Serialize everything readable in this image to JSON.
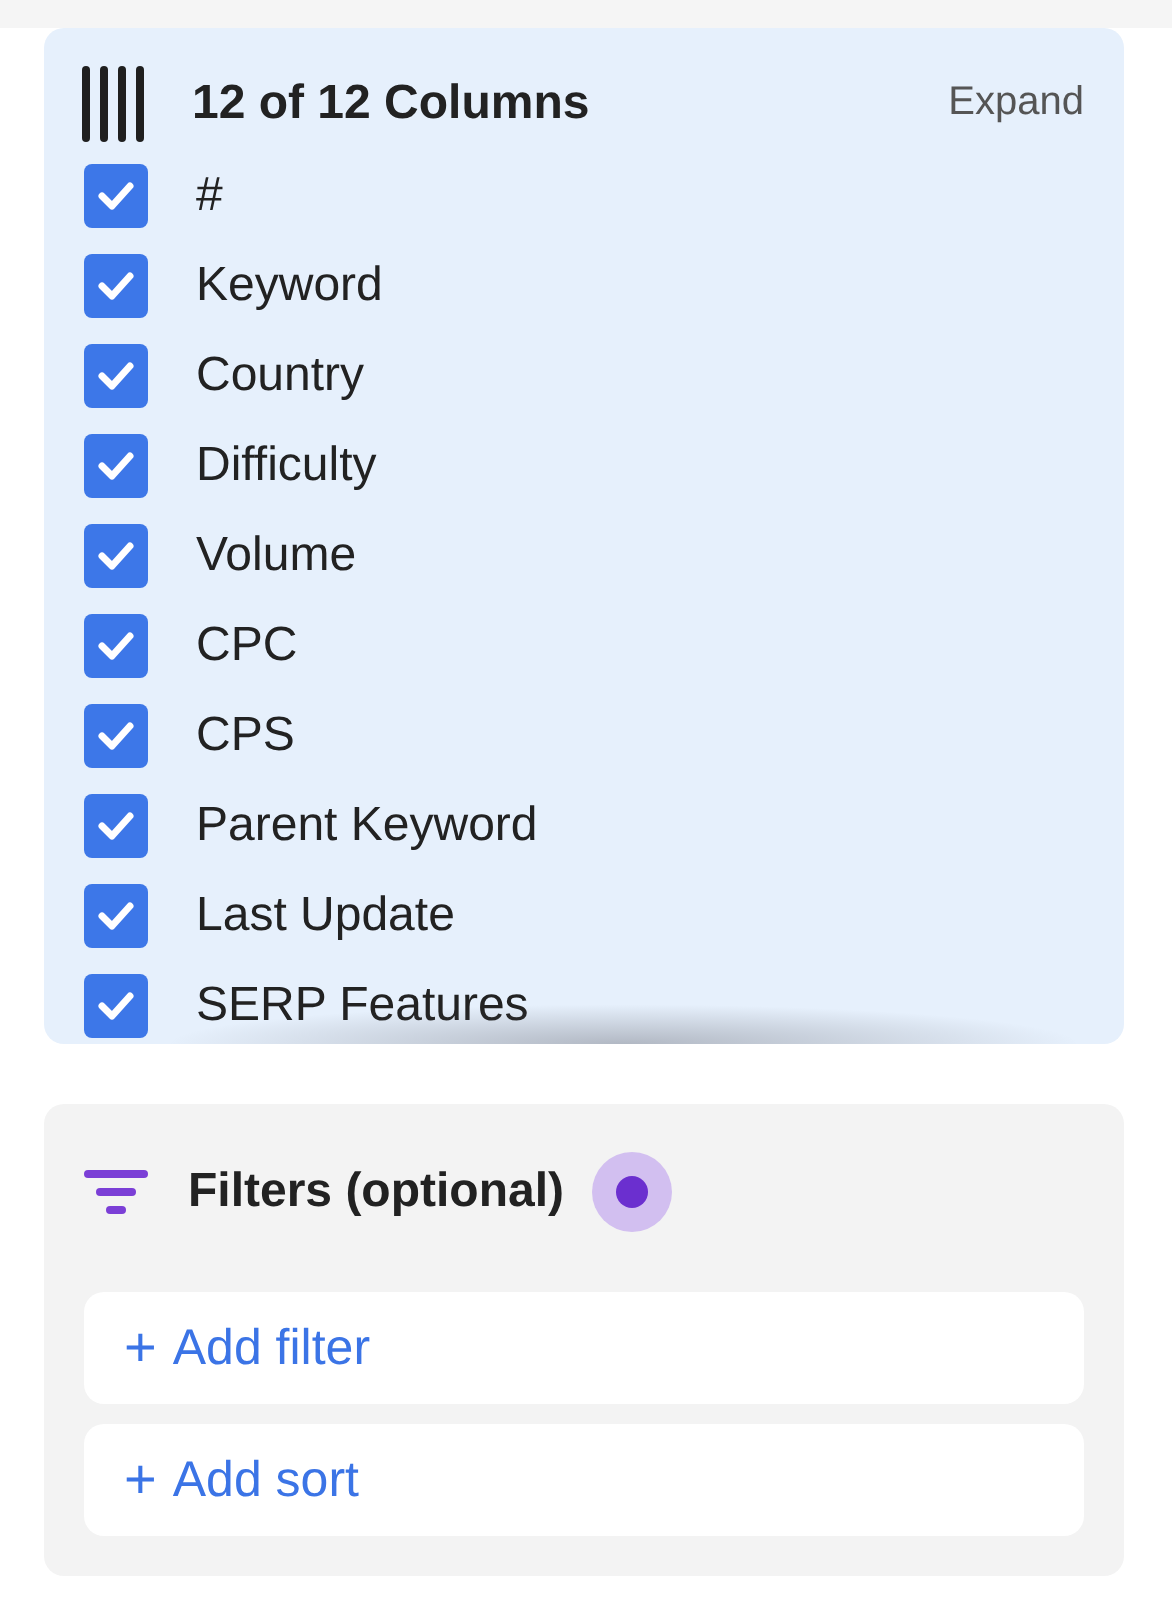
{
  "columns_panel": {
    "title": "12 of 12 Columns",
    "expand_link": "Expand",
    "columns": [
      {
        "label": "#",
        "checked": true
      },
      {
        "label": "Keyword",
        "checked": true
      },
      {
        "label": "Country",
        "checked": true
      },
      {
        "label": "Difficulty",
        "checked": true
      },
      {
        "label": "Volume",
        "checked": true
      },
      {
        "label": "CPC",
        "checked": true
      },
      {
        "label": "CPS",
        "checked": true
      },
      {
        "label": "Parent Keyword",
        "checked": true
      },
      {
        "label": "Last Update",
        "checked": true
      },
      {
        "label": "SERP Features",
        "checked": true
      }
    ]
  },
  "filters_panel": {
    "title": "Filters (optional)",
    "buttons": [
      {
        "icon": "+",
        "label": "Add filter"
      },
      {
        "icon": "+",
        "label": "Add sort"
      }
    ]
  }
}
